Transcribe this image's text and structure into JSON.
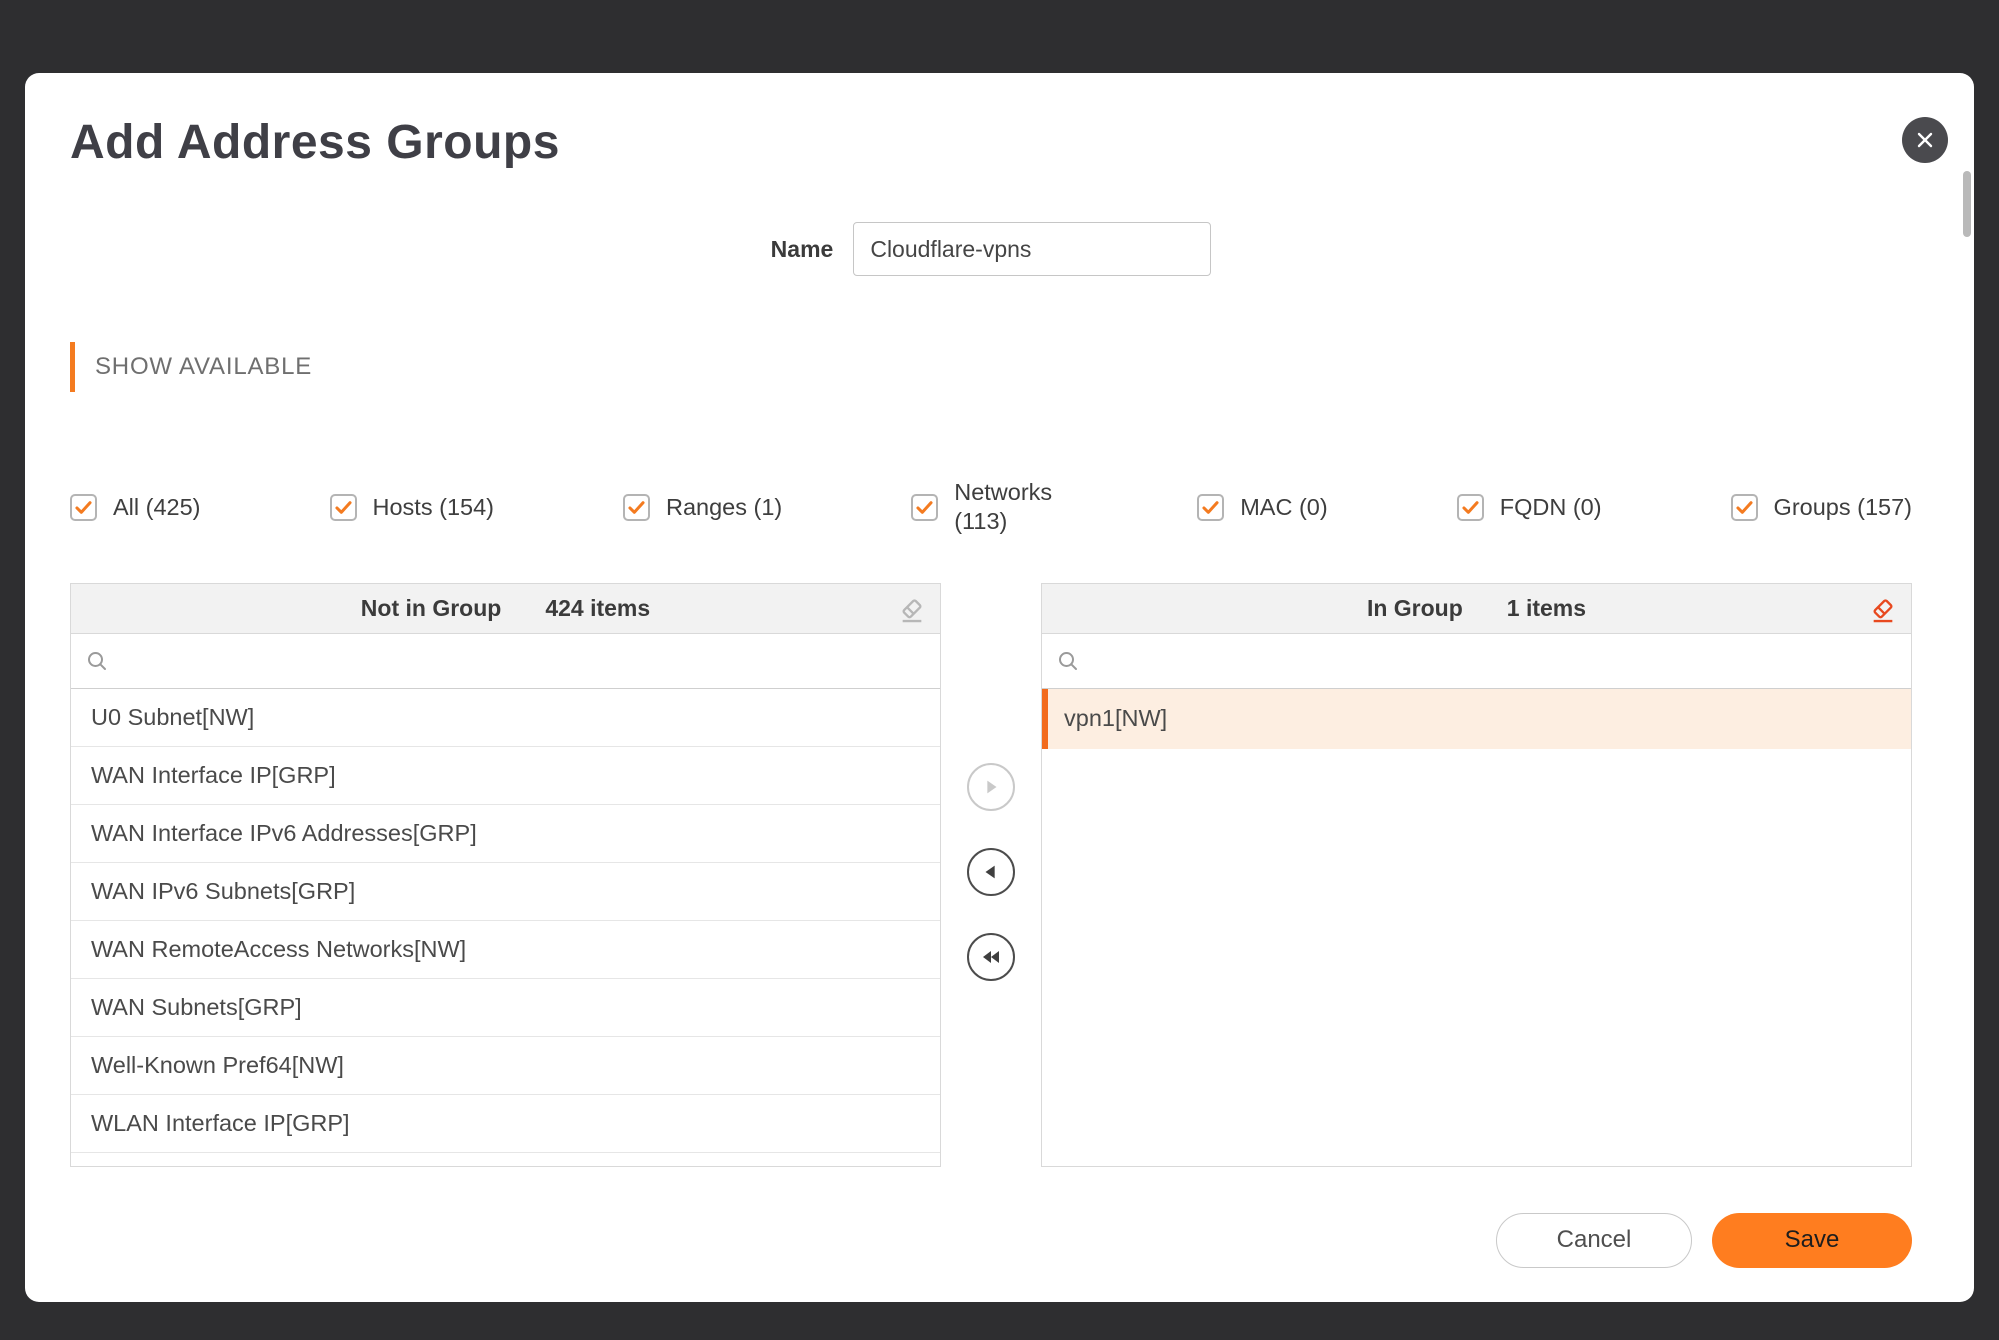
{
  "colors": {
    "accent": "#f47b20",
    "save_button": "#ff7d1f",
    "selected_row_bg": "#fdeee1",
    "selected_row_border": "#f26b1d",
    "eraser_active": "#e8491f",
    "eraser_inactive": "#b7b7b7",
    "backdrop": "#2e2e30"
  },
  "icons": [
    "close-icon",
    "search-icon",
    "eraser-icon",
    "check-icon",
    "move-right-icon",
    "move-left-icon",
    "move-all-left-icon"
  ],
  "dialog": {
    "title": "Add Address Groups"
  },
  "name_field": {
    "label": "Name",
    "value": "Cloudflare-vpns"
  },
  "section": {
    "show_available": "SHOW AVAILABLE"
  },
  "filters": [
    {
      "label": "All (425)",
      "checked": true
    },
    {
      "label": "Hosts (154)",
      "checked": true
    },
    {
      "label": "Ranges (1)",
      "checked": true
    },
    {
      "label": "Networks (113)",
      "checked": true
    },
    {
      "label": "MAC (0)",
      "checked": true
    },
    {
      "label": "FQDN (0)",
      "checked": true
    },
    {
      "label": "Groups (157)",
      "checked": true
    }
  ],
  "not_in_group": {
    "title": "Not in Group",
    "count": "424 items",
    "items": [
      "U0 Subnet[NW]",
      "WAN Interface IP[GRP]",
      "WAN Interface IPv6 Addresses[GRP]",
      "WAN IPv6 Subnets[GRP]",
      "WAN RemoteAccess Networks[NW]",
      "WAN Subnets[GRP]",
      "Well-Known Pref64[NW]",
      "WLAN Interface IP[GRP]"
    ]
  },
  "in_group": {
    "title": "In Group",
    "count": "1 items",
    "items": [
      "vpn1[NW]"
    ]
  },
  "footer": {
    "cancel": "Cancel",
    "save": "Save"
  }
}
